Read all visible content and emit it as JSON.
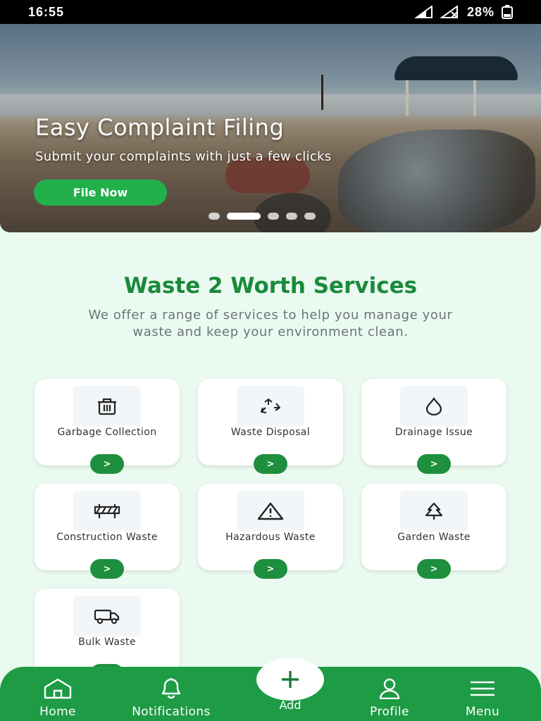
{
  "status_bar": {
    "time": "16:55",
    "battery": "28%"
  },
  "banner": {
    "title": "Easy Complaint Filing",
    "subtitle": "Submit your complaints with just a few clicks",
    "cta_label": "File Now",
    "slide_count": 5,
    "active_slide": 2
  },
  "services": {
    "title": "Waste 2 Worth Services",
    "description": "We offer a range of services to help you manage your waste and keep your environment clean.",
    "go_label": ">",
    "items": [
      {
        "label": "Garbage Collection",
        "icon": "trash-bin-icon"
      },
      {
        "label": "Waste Disposal",
        "icon": "recycle-icon"
      },
      {
        "label": "Drainage Issue",
        "icon": "water-drop-icon"
      },
      {
        "label": "Construction Waste",
        "icon": "barrier-icon"
      },
      {
        "label": "Hazardous Waste",
        "icon": "warning-triangle-icon"
      },
      {
        "label": "Garden Waste",
        "icon": "tree-icon"
      },
      {
        "label": "Bulk Waste",
        "icon": "truck-icon"
      }
    ]
  },
  "bottom_nav": {
    "home": "Home",
    "notifications": "Notifications",
    "add": "Add",
    "profile": "Profile",
    "menu": "Menu"
  },
  "colors": {
    "brand_green": "#1e9b45",
    "heading_green": "#1a8a3a",
    "cta_green": "#22b04b",
    "page_bg": "#eafaf0"
  }
}
